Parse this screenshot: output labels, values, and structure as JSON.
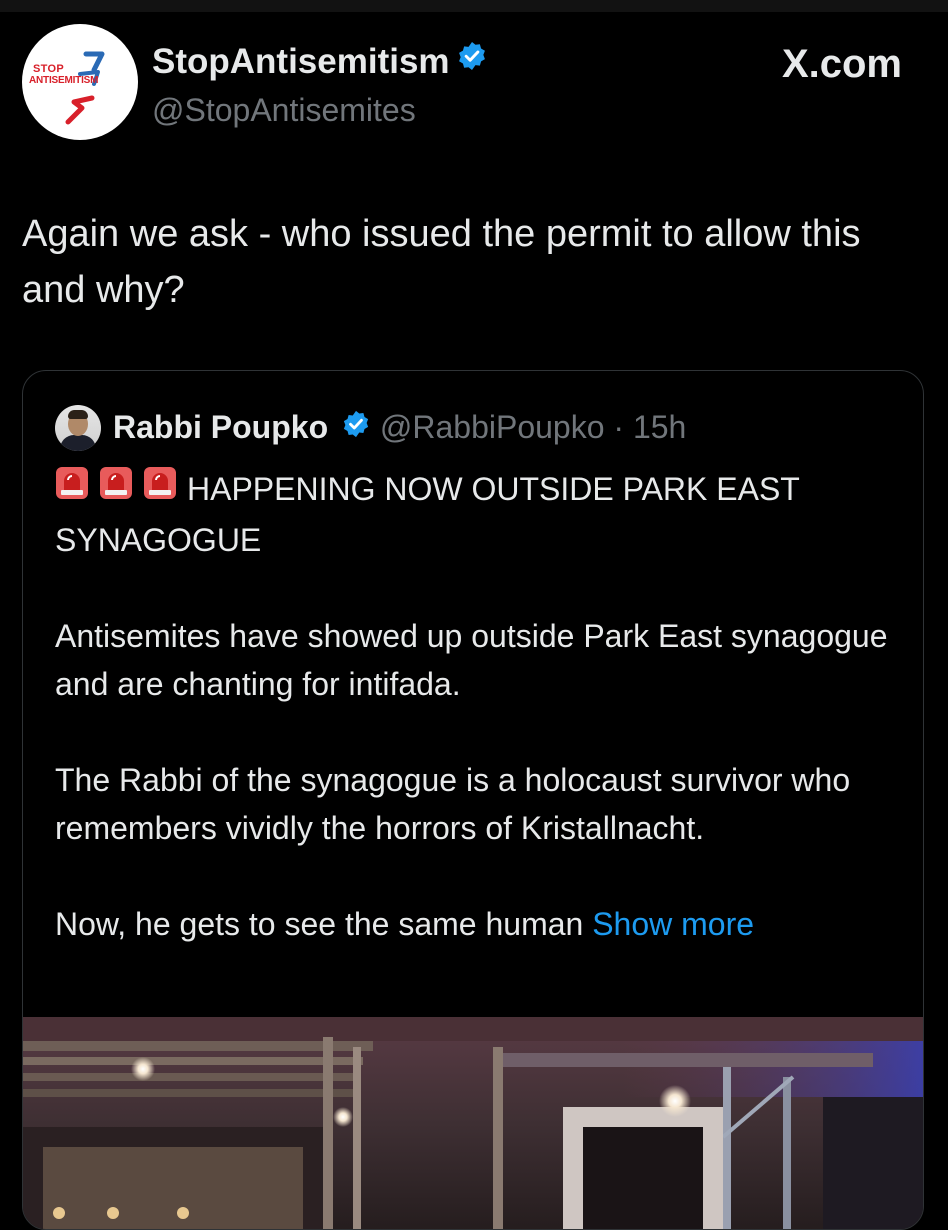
{
  "tweet": {
    "avatar_text_top": "STOP",
    "avatar_text_bottom": "ANTISEMITISM",
    "display_name": "StopAntisemitism",
    "handle": "@StopAntisemites",
    "brand": "X.com",
    "text": "Again we ask - who issued the permit to allow this and why?"
  },
  "quote": {
    "display_name": "Rabbi Poupko",
    "handle": "@RabbiPoupko",
    "separator": " · ",
    "time": "15h",
    "headline": "HAPPENING NOW OUTSIDE PARK EAST SYNAGOGUE",
    "para1": "Antisemites have showed up outside Park East synagogue and are chanting for intifada.",
    "para2": "The Rabbi of the synagogue is a holocaust survivor who remembers vividly the horrors of Kristallnacht.",
    "para3": "Now, he gets to see the same human",
    "show_more": "Show more"
  },
  "colors": {
    "background": "#000000",
    "text": "#e7e9ea",
    "secondary_text": "#71767b",
    "link": "#1d9bf0",
    "verified": "#1d9bf0",
    "border": "#2f3336"
  },
  "icons": {
    "verified": "verified-badge-icon",
    "siren": "police-light-emoji"
  }
}
